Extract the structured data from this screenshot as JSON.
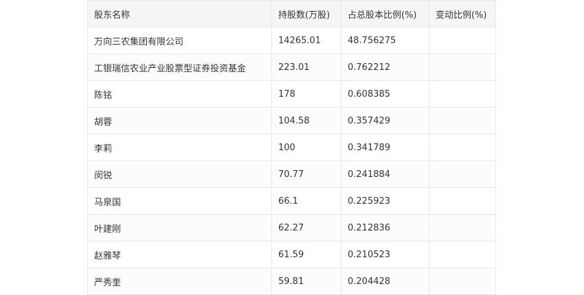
{
  "table": {
    "headers": [
      "股东名称",
      "持股数(万股)",
      "占总股本比例(%)",
      "变动比例(%)"
    ],
    "rows": [
      [
        "万向三农集团有限公司",
        "14265.01",
        "48.756275",
        ""
      ],
      [
        "工银瑞信农业产业股票型证券投资基金",
        "223.01",
        "0.762212",
        ""
      ],
      [
        "陈铭",
        "178",
        "0.608385",
        ""
      ],
      [
        "胡蓉",
        "104.58",
        "0.357429",
        ""
      ],
      [
        "李莉",
        "100",
        "0.341789",
        ""
      ],
      [
        "闵锐",
        "70.77",
        "0.241884",
        ""
      ],
      [
        "马泉国",
        "66.1",
        "0.225923",
        ""
      ],
      [
        "叶建刚",
        "62.27",
        "0.212836",
        ""
      ],
      [
        "赵雅琴",
        "61.59",
        "0.210523",
        ""
      ],
      [
        "严秀奎",
        "59.81",
        "0.204428",
        ""
      ]
    ]
  }
}
